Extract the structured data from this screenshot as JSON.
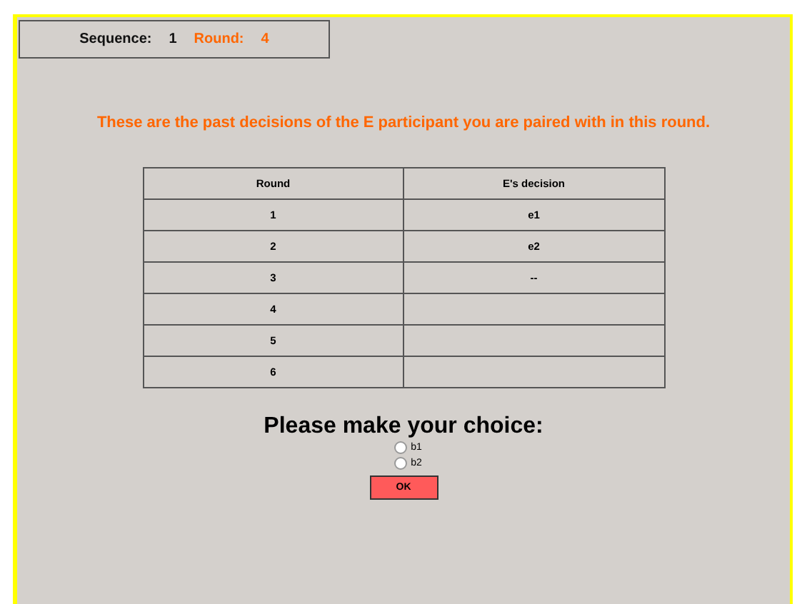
{
  "header": {
    "sequence_label": "Sequence:",
    "sequence": "1",
    "round_label": "Round:",
    "round": "4"
  },
  "message": "These are the past decisions of the E participant you are paired with in this round.",
  "table": {
    "columns": [
      "Round",
      "E's decision"
    ],
    "rows": [
      {
        "round": "1",
        "decision": "e1"
      },
      {
        "round": "2",
        "decision": "e2"
      },
      {
        "round": "3",
        "decision": "--"
      },
      {
        "round": "4",
        "decision": ""
      },
      {
        "round": "5",
        "decision": ""
      },
      {
        "round": "6",
        "decision": ""
      }
    ]
  },
  "prompt": "Please make your choice:",
  "options": [
    {
      "label": "b1",
      "selected": false
    },
    {
      "label": "b2",
      "selected": false
    }
  ],
  "button": "OK"
}
